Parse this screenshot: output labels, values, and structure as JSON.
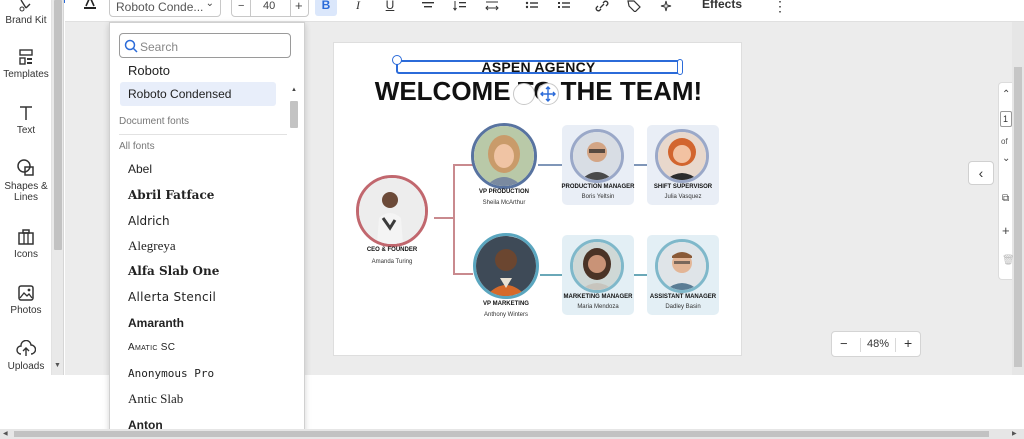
{
  "sidebar": {
    "items": [
      {
        "label": "Brand Kit",
        "icon": "brand-kit-icon"
      },
      {
        "label": "Templates",
        "icon": "templates-icon"
      },
      {
        "label": "Text",
        "icon": "text-icon"
      },
      {
        "label": "Shapes &",
        "label2": "Lines",
        "icon": "shapes-icon"
      },
      {
        "label": "Icons",
        "icon": "icons-icon"
      },
      {
        "label": "Photos",
        "icon": "photos-icon"
      },
      {
        "label": "Uploads",
        "icon": "uploads-icon"
      }
    ]
  },
  "toolbar": {
    "font_value": "Roboto Conde...",
    "size_minus": "−",
    "size_value": "40",
    "size_plus": "+",
    "bold": "B",
    "italic": "I",
    "underline": "U",
    "effects_label": "Effects",
    "more": "⋮"
  },
  "font_dropdown": {
    "search_placeholder": "Search",
    "recent": [
      {
        "label": "Roboto",
        "selected": false
      },
      {
        "label": "Roboto Condensed",
        "selected": true
      }
    ],
    "document_fonts_label": "Document fonts",
    "all_fonts_label": "All fonts",
    "fonts": [
      "Abel",
      "Abril Fatface",
      "Aldrich",
      "Alegreya",
      "Alfa Slab One",
      "Allerta Stencil",
      "Amaranth",
      "Amatic SC",
      "Anonymous Pro",
      "Antic Slab",
      "Anton"
    ]
  },
  "canvas": {
    "agency": "ASPEN AGENCY",
    "welcome": "WELCOME TO THE TEAM!",
    "people": {
      "ceo": {
        "title": "CEO & FOUNDER",
        "name": "Amanda Turing",
        "ring": "#c1676e"
      },
      "vp_production": {
        "title": "VP PRODUCTION",
        "name": "Sheila McArthur",
        "ring": "#5873a0"
      },
      "production_manager": {
        "title": "PRODUCTION MANAGER",
        "name": "Boris Yeltsin",
        "ring": "#9aa8c8"
      },
      "shift_supervisor": {
        "title": "SHIFT SUPERVISOR",
        "name": "Julia Vasquez",
        "ring": "#9aa8c8"
      },
      "vp_marketing": {
        "title": "VP MARKETING",
        "name": "Anthony Winters",
        "ring": "#5aa6bf"
      },
      "marketing_manager": {
        "title": "MARKETING MANAGER",
        "name": "Maria Mendoza",
        "ring": "#7fb8ca"
      },
      "assistant_manager": {
        "title": "ASSISTANT MANAGER",
        "name": "Dadley Basin",
        "ring": "#7fb8ca"
      }
    }
  },
  "right_panel": {
    "page_number": "1",
    "of_label": "of"
  },
  "zoom": {
    "minus": "−",
    "value": "48%",
    "plus": "+"
  },
  "colors": {
    "accent": "#2b6bd9",
    "selected_font_bg": "#e8eefa"
  }
}
